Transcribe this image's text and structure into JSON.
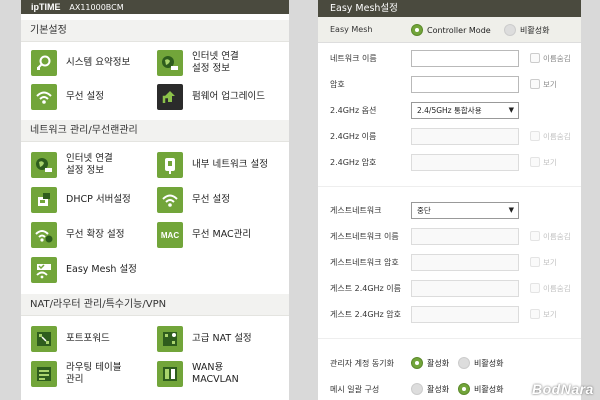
{
  "left": {
    "brand": "ipTIME",
    "model": "AX11000BCM",
    "sections": [
      {
        "title": "기본설정",
        "items": [
          {
            "label": "시스템 요약정보",
            "icon": "magnifier-icon"
          },
          {
            "label": "인터넷 연결\n설정 정보",
            "icon": "globe-icon"
          },
          {
            "label": "무선 설정",
            "icon": "wifi-icon"
          },
          {
            "label": "펌웨어 업그레이드",
            "icon": "upgrade-icon"
          }
        ]
      },
      {
        "title": "네트워크 관리/무선랜관리",
        "items": [
          {
            "label": "인터넷 연결\n설정 정보",
            "icon": "globe-icon"
          },
          {
            "label": "내부 네트워크 설정",
            "icon": "lan-icon"
          },
          {
            "label": "DHCP 서버설정",
            "icon": "dhcp-icon"
          },
          {
            "label": "무선 설정",
            "icon": "wifi-icon"
          },
          {
            "label": "무선 확장 설정",
            "icon": "wifi-extend-icon"
          },
          {
            "label": "무선 MAC관리",
            "icon": "mac-icon"
          },
          {
            "label": "Easy Mesh 설정",
            "icon": "mesh-icon"
          }
        ]
      },
      {
        "title": "NAT/라우터 관리/특수기능/VPN",
        "items": [
          {
            "label": "포트포워드",
            "icon": "port-forward-icon"
          },
          {
            "label": "고급 NAT 설정",
            "icon": "advanced-nat-icon"
          },
          {
            "label": "라우팅 테이블\n관리",
            "icon": "routing-icon"
          },
          {
            "label": "WAN용\nMACVLAN",
            "icon": "macvlan-icon"
          }
        ]
      }
    ],
    "mac_tile_text": "MAC"
  },
  "right": {
    "title": "Easy Mesh설정",
    "mode": {
      "label": "Easy Mesh",
      "opt_controller": "Controller Mode",
      "opt_disable": "비활성화"
    },
    "network_name": {
      "label": "네트워크 이름",
      "check": "이름숨김"
    },
    "password": {
      "label": "암호",
      "check": "보기"
    },
    "band_option": {
      "label": "2.4GHz 옵션",
      "value": "2.4/5GHz 통합사용"
    },
    "name_24": {
      "label": "2.4GHz 이름",
      "check": "이름숨김"
    },
    "pw_24": {
      "label": "2.4GHz 암호",
      "check": "보기"
    },
    "guest": {
      "label": "게스트네트워크",
      "value": "중단"
    },
    "guest_name": {
      "label": "게스트네트워크 이름",
      "check": "이름숨김"
    },
    "guest_pw": {
      "label": "게스트네트워크 암호",
      "check": "보기"
    },
    "guest_name_24": {
      "label": "게스트 2.4GHz 이름",
      "check": "이름숨김"
    },
    "guest_pw_24": {
      "label": "게스트 2.4GHz 암호",
      "check": "보기"
    },
    "admin_sync": {
      "label": "관리자 계정 동기화",
      "on": "활성화",
      "off": "비활성화"
    },
    "mesh_batch": {
      "label": "메시 일괄 구성",
      "on": "활성화",
      "off": "비활성화"
    }
  },
  "watermark": "BodNara",
  "colors": {
    "accent": "#72a53a",
    "header": "#4a4a3e",
    "section_bg": "#f2f2f0"
  }
}
